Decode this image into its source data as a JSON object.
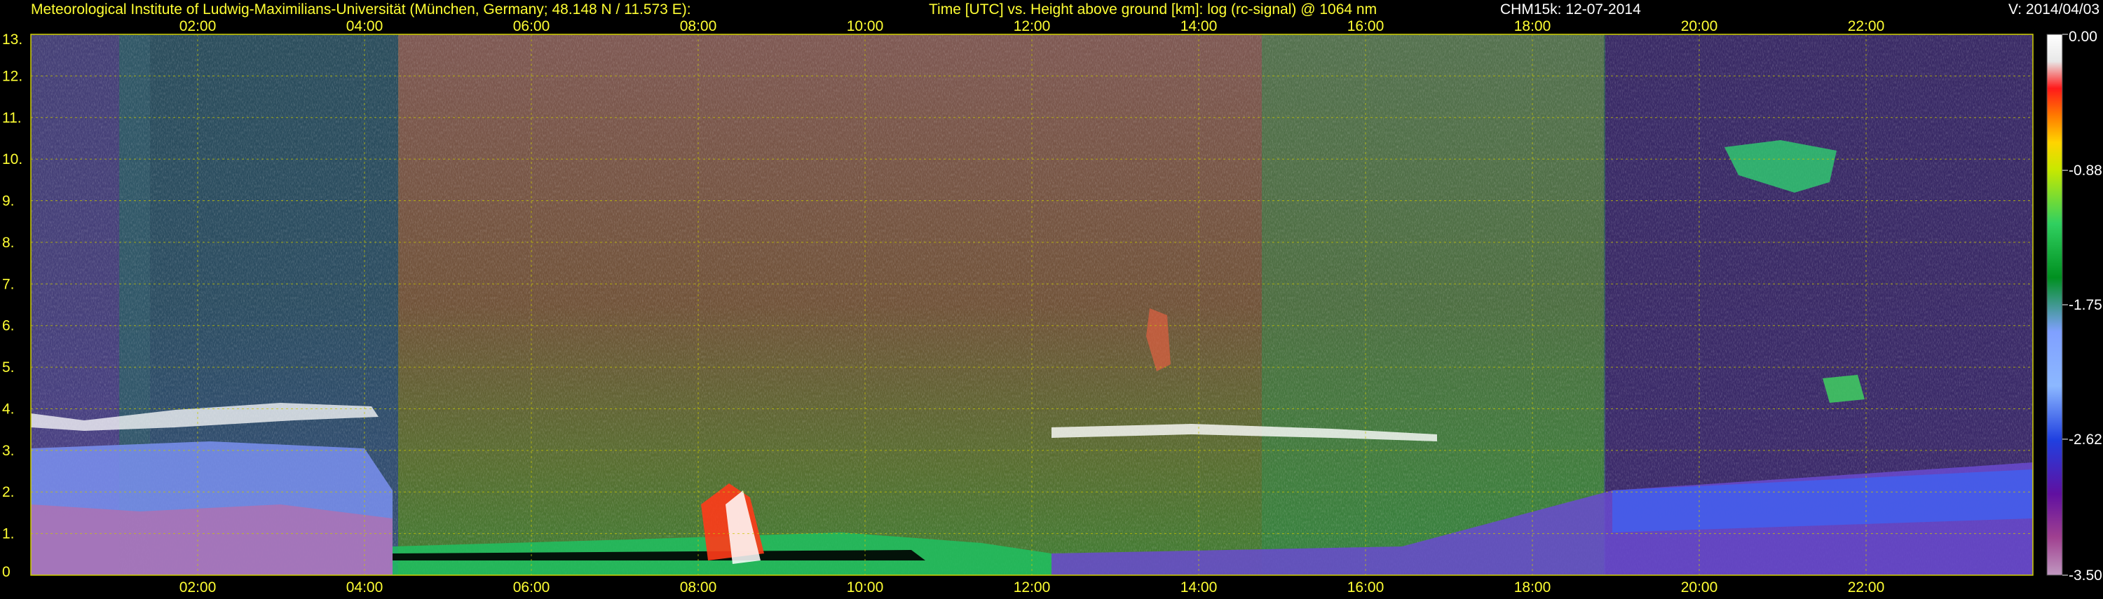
{
  "header": {
    "institute": "Meteorological Institute of Ludwig-Maximilians-Universität (München, Germany; 48.148 N / 11.573 E):",
    "axes_desc": "Time [UTC] vs. Height above ground [km]: log (rc-signal) @ 1064 nm",
    "instrument": "CHM15k: 12-07-2014",
    "version": "V: 2014/04/03"
  },
  "chart_data": {
    "type": "heatmap",
    "title": "Time [UTC] vs. Height above ground [km]: log (rc-signal) @ 1064 nm",
    "x_ticks": [
      "02:00",
      "04:00",
      "06:00",
      "08:00",
      "10:00",
      "12:00",
      "14:00",
      "16:00",
      "18:00",
      "20:00",
      "22:00"
    ],
    "x_tick_hours": [
      2,
      4,
      6,
      8,
      10,
      12,
      14,
      16,
      18,
      20,
      22
    ],
    "xlim_hours": [
      0,
      24
    ],
    "y_ticks": [
      "0",
      "1.",
      "2.",
      "3.",
      "4.",
      "5.",
      "6.",
      "7.",
      "8.",
      "9.",
      "10.",
      "11.",
      "12.",
      "13."
    ],
    "y_tick_values": [
      0,
      1,
      2,
      3,
      4,
      5,
      6,
      7,
      8,
      9,
      10,
      11,
      12,
      13
    ],
    "ylim_km": [
      0,
      13
    ],
    "grid": true,
    "colorbar": {
      "labels": [
        "0.00",
        "-0.88",
        "-1.75",
        "-2.62",
        "-3.50"
      ],
      "values": [
        0.0,
        -0.88,
        -1.75,
        -2.62,
        -3.5
      ],
      "range": [
        -3.5,
        0.0
      ]
    },
    "colors": {
      "background": "#000000",
      "grid": "#c8c800",
      "header_text": "#ffff33",
      "version_text": "#ffffff"
    }
  }
}
